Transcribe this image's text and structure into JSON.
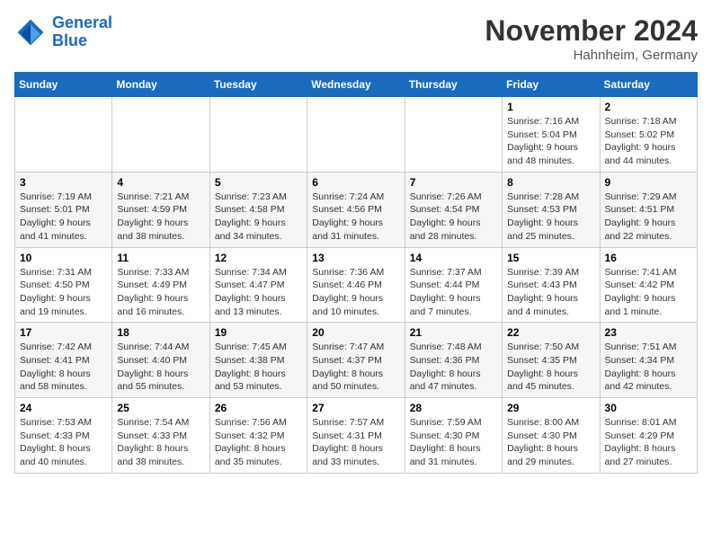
{
  "logo": {
    "line1": "General",
    "line2": "Blue"
  },
  "title": "November 2024",
  "location": "Hahnheim, Germany",
  "weekdays": [
    "Sunday",
    "Monday",
    "Tuesday",
    "Wednesday",
    "Thursday",
    "Friday",
    "Saturday"
  ],
  "weeks": [
    [
      {
        "day": "",
        "info": ""
      },
      {
        "day": "",
        "info": ""
      },
      {
        "day": "",
        "info": ""
      },
      {
        "day": "",
        "info": ""
      },
      {
        "day": "",
        "info": ""
      },
      {
        "day": "1",
        "info": "Sunrise: 7:16 AM\nSunset: 5:04 PM\nDaylight: 9 hours and 48 minutes."
      },
      {
        "day": "2",
        "info": "Sunrise: 7:18 AM\nSunset: 5:02 PM\nDaylight: 9 hours and 44 minutes."
      }
    ],
    [
      {
        "day": "3",
        "info": "Sunrise: 7:19 AM\nSunset: 5:01 PM\nDaylight: 9 hours and 41 minutes."
      },
      {
        "day": "4",
        "info": "Sunrise: 7:21 AM\nSunset: 4:59 PM\nDaylight: 9 hours and 38 minutes."
      },
      {
        "day": "5",
        "info": "Sunrise: 7:23 AM\nSunset: 4:58 PM\nDaylight: 9 hours and 34 minutes."
      },
      {
        "day": "6",
        "info": "Sunrise: 7:24 AM\nSunset: 4:56 PM\nDaylight: 9 hours and 31 minutes."
      },
      {
        "day": "7",
        "info": "Sunrise: 7:26 AM\nSunset: 4:54 PM\nDaylight: 9 hours and 28 minutes."
      },
      {
        "day": "8",
        "info": "Sunrise: 7:28 AM\nSunset: 4:53 PM\nDaylight: 9 hours and 25 minutes."
      },
      {
        "day": "9",
        "info": "Sunrise: 7:29 AM\nSunset: 4:51 PM\nDaylight: 9 hours and 22 minutes."
      }
    ],
    [
      {
        "day": "10",
        "info": "Sunrise: 7:31 AM\nSunset: 4:50 PM\nDaylight: 9 hours and 19 minutes."
      },
      {
        "day": "11",
        "info": "Sunrise: 7:33 AM\nSunset: 4:49 PM\nDaylight: 9 hours and 16 minutes."
      },
      {
        "day": "12",
        "info": "Sunrise: 7:34 AM\nSunset: 4:47 PM\nDaylight: 9 hours and 13 minutes."
      },
      {
        "day": "13",
        "info": "Sunrise: 7:36 AM\nSunset: 4:46 PM\nDaylight: 9 hours and 10 minutes."
      },
      {
        "day": "14",
        "info": "Sunrise: 7:37 AM\nSunset: 4:44 PM\nDaylight: 9 hours and 7 minutes."
      },
      {
        "day": "15",
        "info": "Sunrise: 7:39 AM\nSunset: 4:43 PM\nDaylight: 9 hours and 4 minutes."
      },
      {
        "day": "16",
        "info": "Sunrise: 7:41 AM\nSunset: 4:42 PM\nDaylight: 9 hours and 1 minute."
      }
    ],
    [
      {
        "day": "17",
        "info": "Sunrise: 7:42 AM\nSunset: 4:41 PM\nDaylight: 8 hours and 58 minutes."
      },
      {
        "day": "18",
        "info": "Sunrise: 7:44 AM\nSunset: 4:40 PM\nDaylight: 8 hours and 55 minutes."
      },
      {
        "day": "19",
        "info": "Sunrise: 7:45 AM\nSunset: 4:38 PM\nDaylight: 8 hours and 53 minutes."
      },
      {
        "day": "20",
        "info": "Sunrise: 7:47 AM\nSunset: 4:37 PM\nDaylight: 8 hours and 50 minutes."
      },
      {
        "day": "21",
        "info": "Sunrise: 7:48 AM\nSunset: 4:36 PM\nDaylight: 8 hours and 47 minutes."
      },
      {
        "day": "22",
        "info": "Sunrise: 7:50 AM\nSunset: 4:35 PM\nDaylight: 8 hours and 45 minutes."
      },
      {
        "day": "23",
        "info": "Sunrise: 7:51 AM\nSunset: 4:34 PM\nDaylight: 8 hours and 42 minutes."
      }
    ],
    [
      {
        "day": "24",
        "info": "Sunrise: 7:53 AM\nSunset: 4:33 PM\nDaylight: 8 hours and 40 minutes."
      },
      {
        "day": "25",
        "info": "Sunrise: 7:54 AM\nSunset: 4:33 PM\nDaylight: 8 hours and 38 minutes."
      },
      {
        "day": "26",
        "info": "Sunrise: 7:56 AM\nSunset: 4:32 PM\nDaylight: 8 hours and 35 minutes."
      },
      {
        "day": "27",
        "info": "Sunrise: 7:57 AM\nSunset: 4:31 PM\nDaylight: 8 hours and 33 minutes."
      },
      {
        "day": "28",
        "info": "Sunrise: 7:59 AM\nSunset: 4:30 PM\nDaylight: 8 hours and 31 minutes."
      },
      {
        "day": "29",
        "info": "Sunrise: 8:00 AM\nSunset: 4:30 PM\nDaylight: 8 hours and 29 minutes."
      },
      {
        "day": "30",
        "info": "Sunrise: 8:01 AM\nSunset: 4:29 PM\nDaylight: 8 hours and 27 minutes."
      }
    ]
  ]
}
